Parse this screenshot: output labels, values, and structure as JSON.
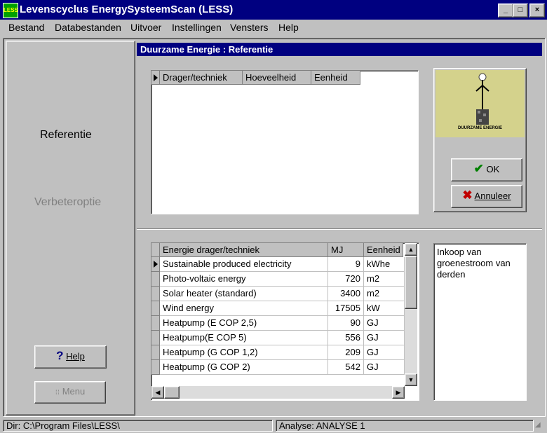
{
  "window": {
    "title": "Levenscyclus EnergySysteemScan (LESS)",
    "icon_label": "LESS",
    "controls": {
      "minimize": "_",
      "maximize": "□",
      "close": "×"
    }
  },
  "menu": [
    "Bestand",
    "Databestanden",
    "Uitvoer",
    "Instellingen",
    "Vensters",
    "Help"
  ],
  "left_panel": {
    "referentie": "Referentie",
    "verbeteroptie": "Verbeteroptie",
    "help_button": "Help",
    "menu_button": "Menu"
  },
  "dialog": {
    "title": "Duurzame Energie :  Referentie",
    "top_grid": {
      "columns": [
        "Drager/techniek",
        "Hoeveelheid",
        "Eenheid"
      ]
    },
    "logo_caption": "DUURZAME ENERGIE",
    "ok_button": "OK",
    "cancel_button": "Annuleer",
    "bottom_grid": {
      "columns": [
        "Energie drager/techniek",
        "MJ",
        "Eenheid"
      ],
      "rows": [
        {
          "name": "Sustainable produced electricity",
          "mj": "9",
          "unit": "kWhe"
        },
        {
          "name": "Photo-voltaic energy",
          "mj": "720",
          "unit": "m2"
        },
        {
          "name": "Solar heater (standard)",
          "mj": "3400",
          "unit": "m2"
        },
        {
          "name": "Wind energy",
          "mj": "17505",
          "unit": "kW"
        },
        {
          "name": "Heatpump (E COP 2,5)",
          "mj": "90",
          "unit": "GJ"
        },
        {
          "name": "Heatpump(E COP 5)",
          "mj": "556",
          "unit": "GJ"
        },
        {
          "name": "Heatpump (G COP 1,2)",
          "mj": "209",
          "unit": "GJ"
        },
        {
          "name": "Heatpump (G COP 2)",
          "mj": "542",
          "unit": "GJ"
        }
      ]
    },
    "description": "Inkoop van groenestroom van derden"
  },
  "statusbar": {
    "dir": "Dir: C:\\Program Files\\LESS\\",
    "analyse": "Analyse: ANALYSE 1"
  },
  "colors": {
    "titlebar": "#000080",
    "face": "#c0c0c0",
    "logo_bg": "#d4d28c",
    "ok_check": "#008000",
    "cancel_x": "#c00000"
  }
}
